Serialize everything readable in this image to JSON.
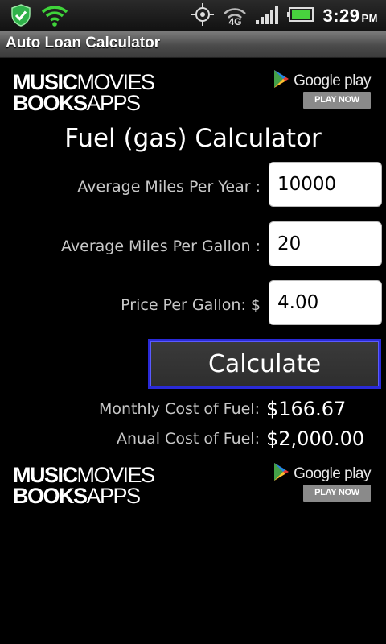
{
  "status_bar": {
    "icons": [
      "shield-check-icon",
      "wifi-icon",
      "gps-icon",
      "4g-icon",
      "signal-icon",
      "battery-icon"
    ],
    "network_label": "4G",
    "time": "3:29",
    "ampm": "PM",
    "colors": {
      "shield": "#2fb24a",
      "wifi": "#3fd43a",
      "battery": "#48d23e"
    }
  },
  "app": {
    "title": "Auto Loan Calculator"
  },
  "ad_banner": {
    "line1_bold": "MUSIC",
    "line1_thin": "MOVIES",
    "line2_bold": "BOOKS",
    "line2_thin": "APPS",
    "store_name": "Google play",
    "cta": "PLAY NOW"
  },
  "calculator": {
    "heading": "Fuel (gas) Calculator",
    "fields": [
      {
        "label": "Average Miles Per Year :",
        "value": "10000"
      },
      {
        "label": "Average Miles Per Gallon :",
        "value": "20"
      },
      {
        "label": "Price Per Gallon: $",
        "value": "4.00"
      }
    ],
    "button_label": "Calculate",
    "results": [
      {
        "label": "Monthly Cost of Fuel:",
        "value": "$166.67"
      },
      {
        "label": "Anual Cost of Fuel:",
        "value": "$2,000.00"
      }
    ]
  },
  "theme": {
    "accent_border": "#2a2ad8",
    "background": "#000000",
    "label_color": "#c8c8c8"
  }
}
